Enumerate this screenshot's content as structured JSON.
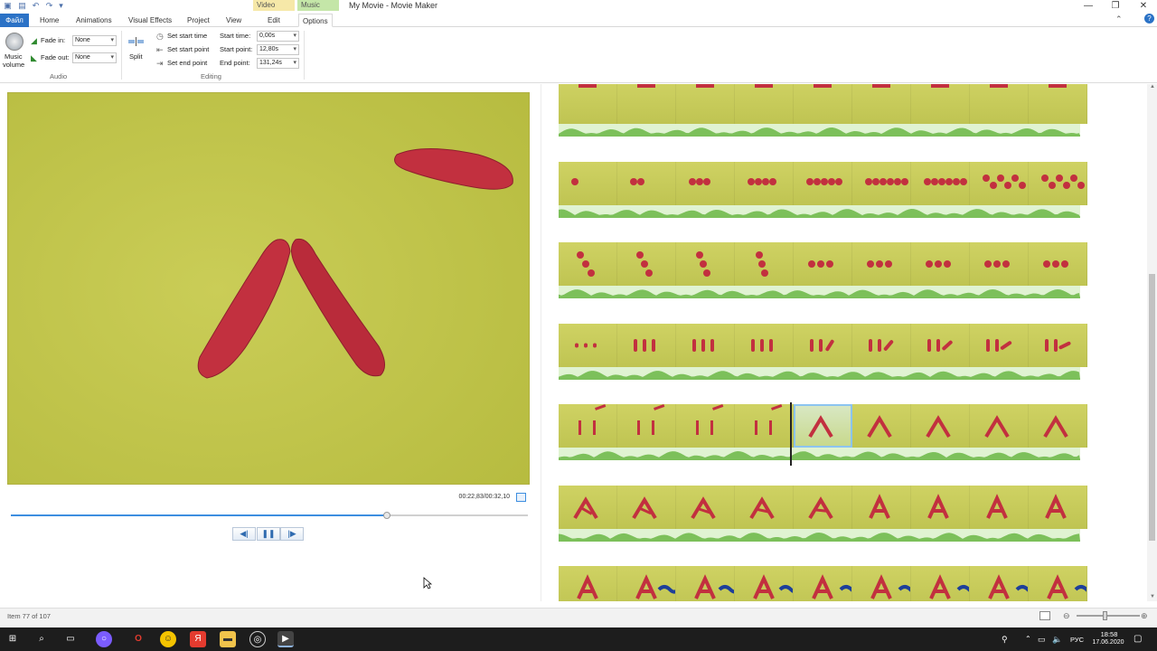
{
  "window": {
    "title": "My Movie - Movie Maker",
    "context_tabs": {
      "video_tools": "Video Tools",
      "music_tools": "Music Tools"
    },
    "controls": {
      "minimize": "—",
      "restore": "❐",
      "close": "✕"
    }
  },
  "tabs": {
    "file": "Файл",
    "home": "Home",
    "animations": "Animations",
    "visual_effects": "Visual Effects",
    "project": "Project",
    "view": "View",
    "edit": "Edit",
    "options": "Options"
  },
  "ribbon": {
    "audio": {
      "music_volume_line1": "Music",
      "music_volume_line2": "volume",
      "fade_in_label": "Fade in:",
      "fade_in_value": "None",
      "fade_out_label": "Fade out:",
      "fade_out_value": "None",
      "group_label": "Audio"
    },
    "editing": {
      "split": "Split",
      "set_start_time": "Set start time",
      "set_start_point": "Set start point",
      "set_end_point": "Set end point",
      "start_time_label": "Start time:",
      "start_time_value": "0,00s",
      "start_point_label": "Start point:",
      "start_point_value": "12,80s",
      "end_point_label": "End point:",
      "end_point_value": "131,24s",
      "group_label": "Editing"
    }
  },
  "preview": {
    "time_readout": "00:22,83/00:32,10",
    "seek_progress": 0.7276
  },
  "storyboard": {
    "strips": 7,
    "selected_strip": 5,
    "selected_frame": 5
  },
  "status": {
    "item": "Item 77 of 107",
    "zoom_level": 0.45
  },
  "taskbar": {
    "time": "18:58",
    "date": "17.06.2020",
    "lang": "РУС"
  },
  "colors": {
    "accent": "#2b72c6",
    "clay": "#c2303f",
    "background_clay_board": "#c4c94a",
    "audio_wave": "#7cc05a"
  }
}
